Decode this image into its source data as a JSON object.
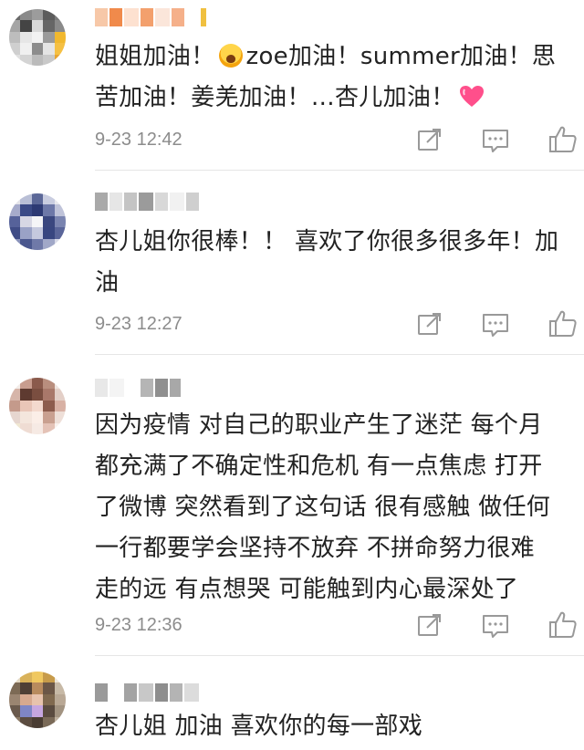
{
  "comments": [
    {
      "lines": [
        "姐姐加油！",
        "zoe加油！summer加油！思",
        "苦加油！姜羌加油！…杏儿加油！"
      ],
      "line1_prefix": "姐姐加油！",
      "line1_suffix": "zoe加油！summer加油！思",
      "line2": "苦加油！姜羌加油！…杏儿加油！",
      "time": "9-23 12:42"
    },
    {
      "line1": "杏儿姐你很棒！！ 喜欢了你很多很多年！加",
      "line2": "油",
      "time": "9-23 12:27"
    },
    {
      "line1": "因为疫情 对自己的职业产生了迷茫 每个月",
      "line2": "都充满了不确定性和危机 有一点焦虑 打开",
      "line3": "了微博 突然看到了这句话 很有感触 做任何",
      "line4": "一行都要学会坚持不放弃 不拼命努力很难",
      "line5": "走的远 有点想哭 可能触到内心最深处了",
      "time": "9-23 12:36"
    },
    {
      "line1": "杏儿姐 加油 喜欢你的每一部戏"
    }
  ],
  "icons": {
    "share": "share-icon",
    "reply": "comment-icon",
    "like": "thumbs-up-icon"
  },
  "colors": {
    "time": "#8c8c8c",
    "icon": "#999999",
    "text": "#222222"
  }
}
